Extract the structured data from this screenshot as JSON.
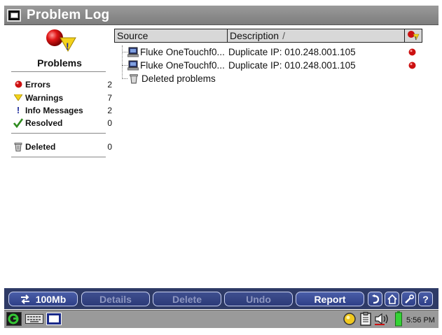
{
  "window": {
    "title": "Problem Log"
  },
  "sidebar": {
    "heading": "Problems",
    "categories": [
      {
        "label": "Errors",
        "count": "2",
        "icon": "red-ball-icon"
      },
      {
        "label": "Warnings",
        "count": "7",
        "icon": "yellow-triangle-icon"
      },
      {
        "label": "Info Messages",
        "count": "2",
        "icon": "exclamation-icon"
      },
      {
        "label": "Resolved",
        "count": "0",
        "icon": "green-check-icon"
      }
    ],
    "deleted": {
      "label": "Deleted",
      "count": "0",
      "icon": "trash-icon"
    }
  },
  "table": {
    "columns": {
      "source": "Source",
      "description": "Description",
      "sort_indicator": "/"
    },
    "rows": [
      {
        "source": "Fluke OneTouchf0...",
        "description": "Duplicate IP: 010.248.001.105",
        "severity": "error"
      },
      {
        "source": "Fluke OneTouchf0...",
        "description": "Duplicate IP: 010.248.001.105",
        "severity": "error"
      }
    ],
    "deleted_node": "Deleted problems"
  },
  "buttonbar": {
    "speed_label": "100Mb",
    "details_label": "Details",
    "delete_label": "Delete",
    "undo_label": "Undo",
    "report_label": "Report",
    "help_label": "?"
  },
  "taskbar": {
    "clock": "5:56 PM"
  },
  "colors": {
    "error_red": "#cc1010",
    "warning_yellow": "#f2d21b",
    "info_blue": "#1c2a9a",
    "resolved_green": "#2e8b1e",
    "button_blue": "#2e3f87"
  }
}
